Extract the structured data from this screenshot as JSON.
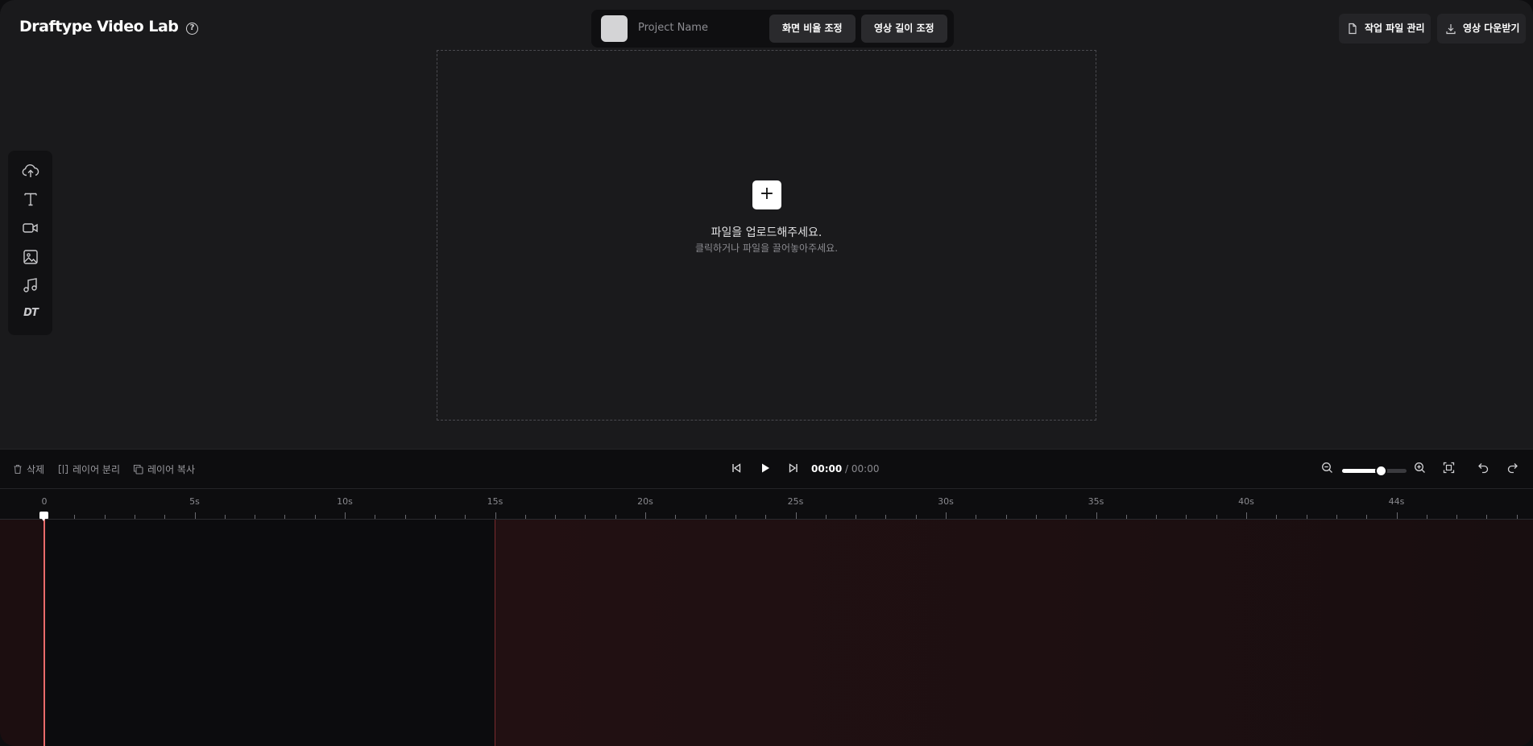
{
  "header": {
    "brand": "Draftype Video Lab",
    "help_icon": "question-circle-icon",
    "help_glyph": "?"
  },
  "project": {
    "name_placeholder": "Project Name",
    "aspect_ratio_button": "화면 비율 조정",
    "duration_button": "영상 길이 조정"
  },
  "top_actions": {
    "manage_files": "작업 파일 관리",
    "download": "영상 다운받기"
  },
  "canvas": {
    "plus_glyph": "+",
    "upload_title": "파일을 업로드해주세요.",
    "upload_subtitle": "클릭하거나 파일을 끌어놓아주세요."
  },
  "tools": [
    {
      "name": "upload-cloud-icon"
    },
    {
      "name": "text-icon"
    },
    {
      "name": "video-icon"
    },
    {
      "name": "image-icon"
    },
    {
      "name": "music-icon"
    },
    {
      "name": "dt-logo-icon",
      "label": "DT"
    }
  ],
  "timeline_toolbar": {
    "delete": "삭제",
    "split_layer": "레이어 분리",
    "copy_layer": "레이어 복사",
    "current_time": "00:00",
    "separator": " / ",
    "total_time": "00:00",
    "zoom_level": 0.6
  },
  "ruler": {
    "labels": [
      "0",
      "5s",
      "10s",
      "15s",
      "20s",
      "25s",
      "30s",
      "35s",
      "40s",
      "44s"
    ]
  },
  "colors": {
    "background": "#1a1a1c",
    "panel": "#0d0d0f",
    "playhead": "#e86a6a",
    "accent_white": "#ffffff"
  }
}
